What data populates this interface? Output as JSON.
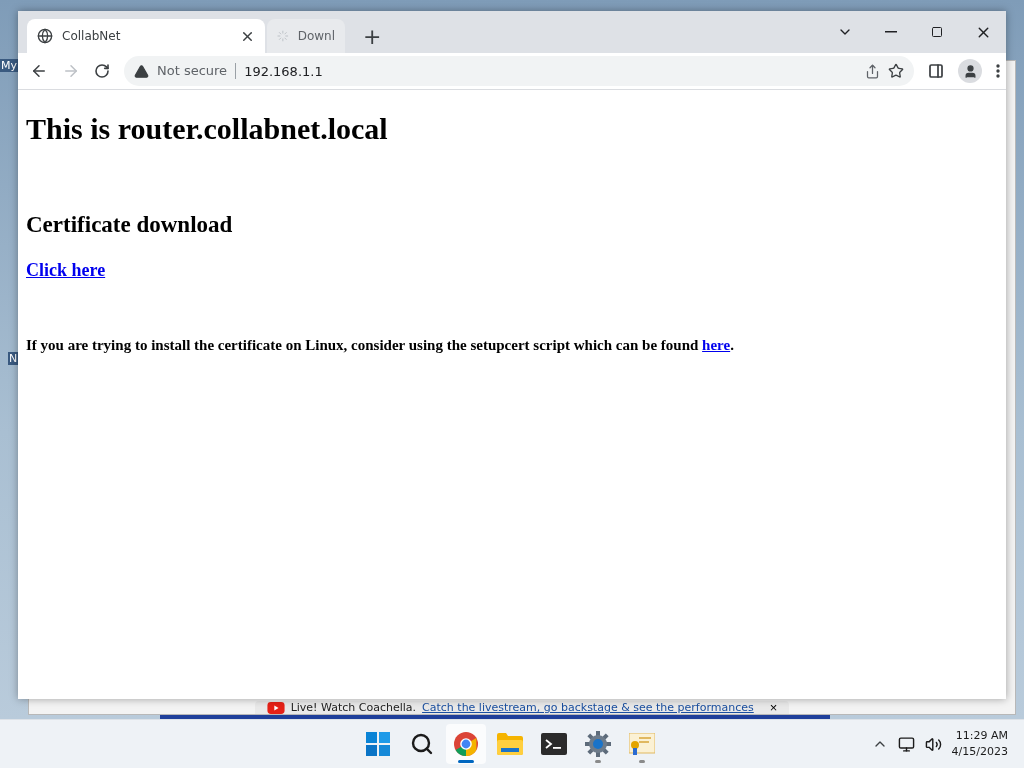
{
  "desktop": {
    "icon_labels": [
      "My",
      "N"
    ]
  },
  "background_window": {
    "banner": {
      "text": "Live! Watch Coachella.",
      "link": "Catch the livestream, go backstage & see the performances",
      "close": "×"
    }
  },
  "browser": {
    "tabs": [
      {
        "title": "CollabNet",
        "selected": true,
        "loading": false
      },
      {
        "title": "Downl",
        "selected": false,
        "loading": true
      }
    ],
    "new_tab": "+",
    "address": {
      "security": "Not secure",
      "url": "192.168.1.1"
    },
    "page": {
      "title": "This is router.collabnet.local",
      "section": "Certificate download",
      "download_link": "Click here",
      "note": "If you are trying to install the certificate on Linux, consider using the setupcert script which can be found",
      "note_link": "here",
      "note_end": "."
    }
  },
  "taskbar": {
    "apps": [
      {
        "kind": "start",
        "active": false,
        "running": false
      },
      {
        "kind": "search",
        "active": false,
        "running": false
      },
      {
        "kind": "chrome",
        "active": true,
        "running": true
      },
      {
        "kind": "files",
        "active": false,
        "running": false
      },
      {
        "kind": "terminal",
        "active": false,
        "running": false
      },
      {
        "kind": "settings",
        "active": false,
        "running": true
      },
      {
        "kind": "certificate",
        "active": false,
        "running": true
      }
    ],
    "time": "11:29 AM",
    "date": "4/15/2023"
  }
}
